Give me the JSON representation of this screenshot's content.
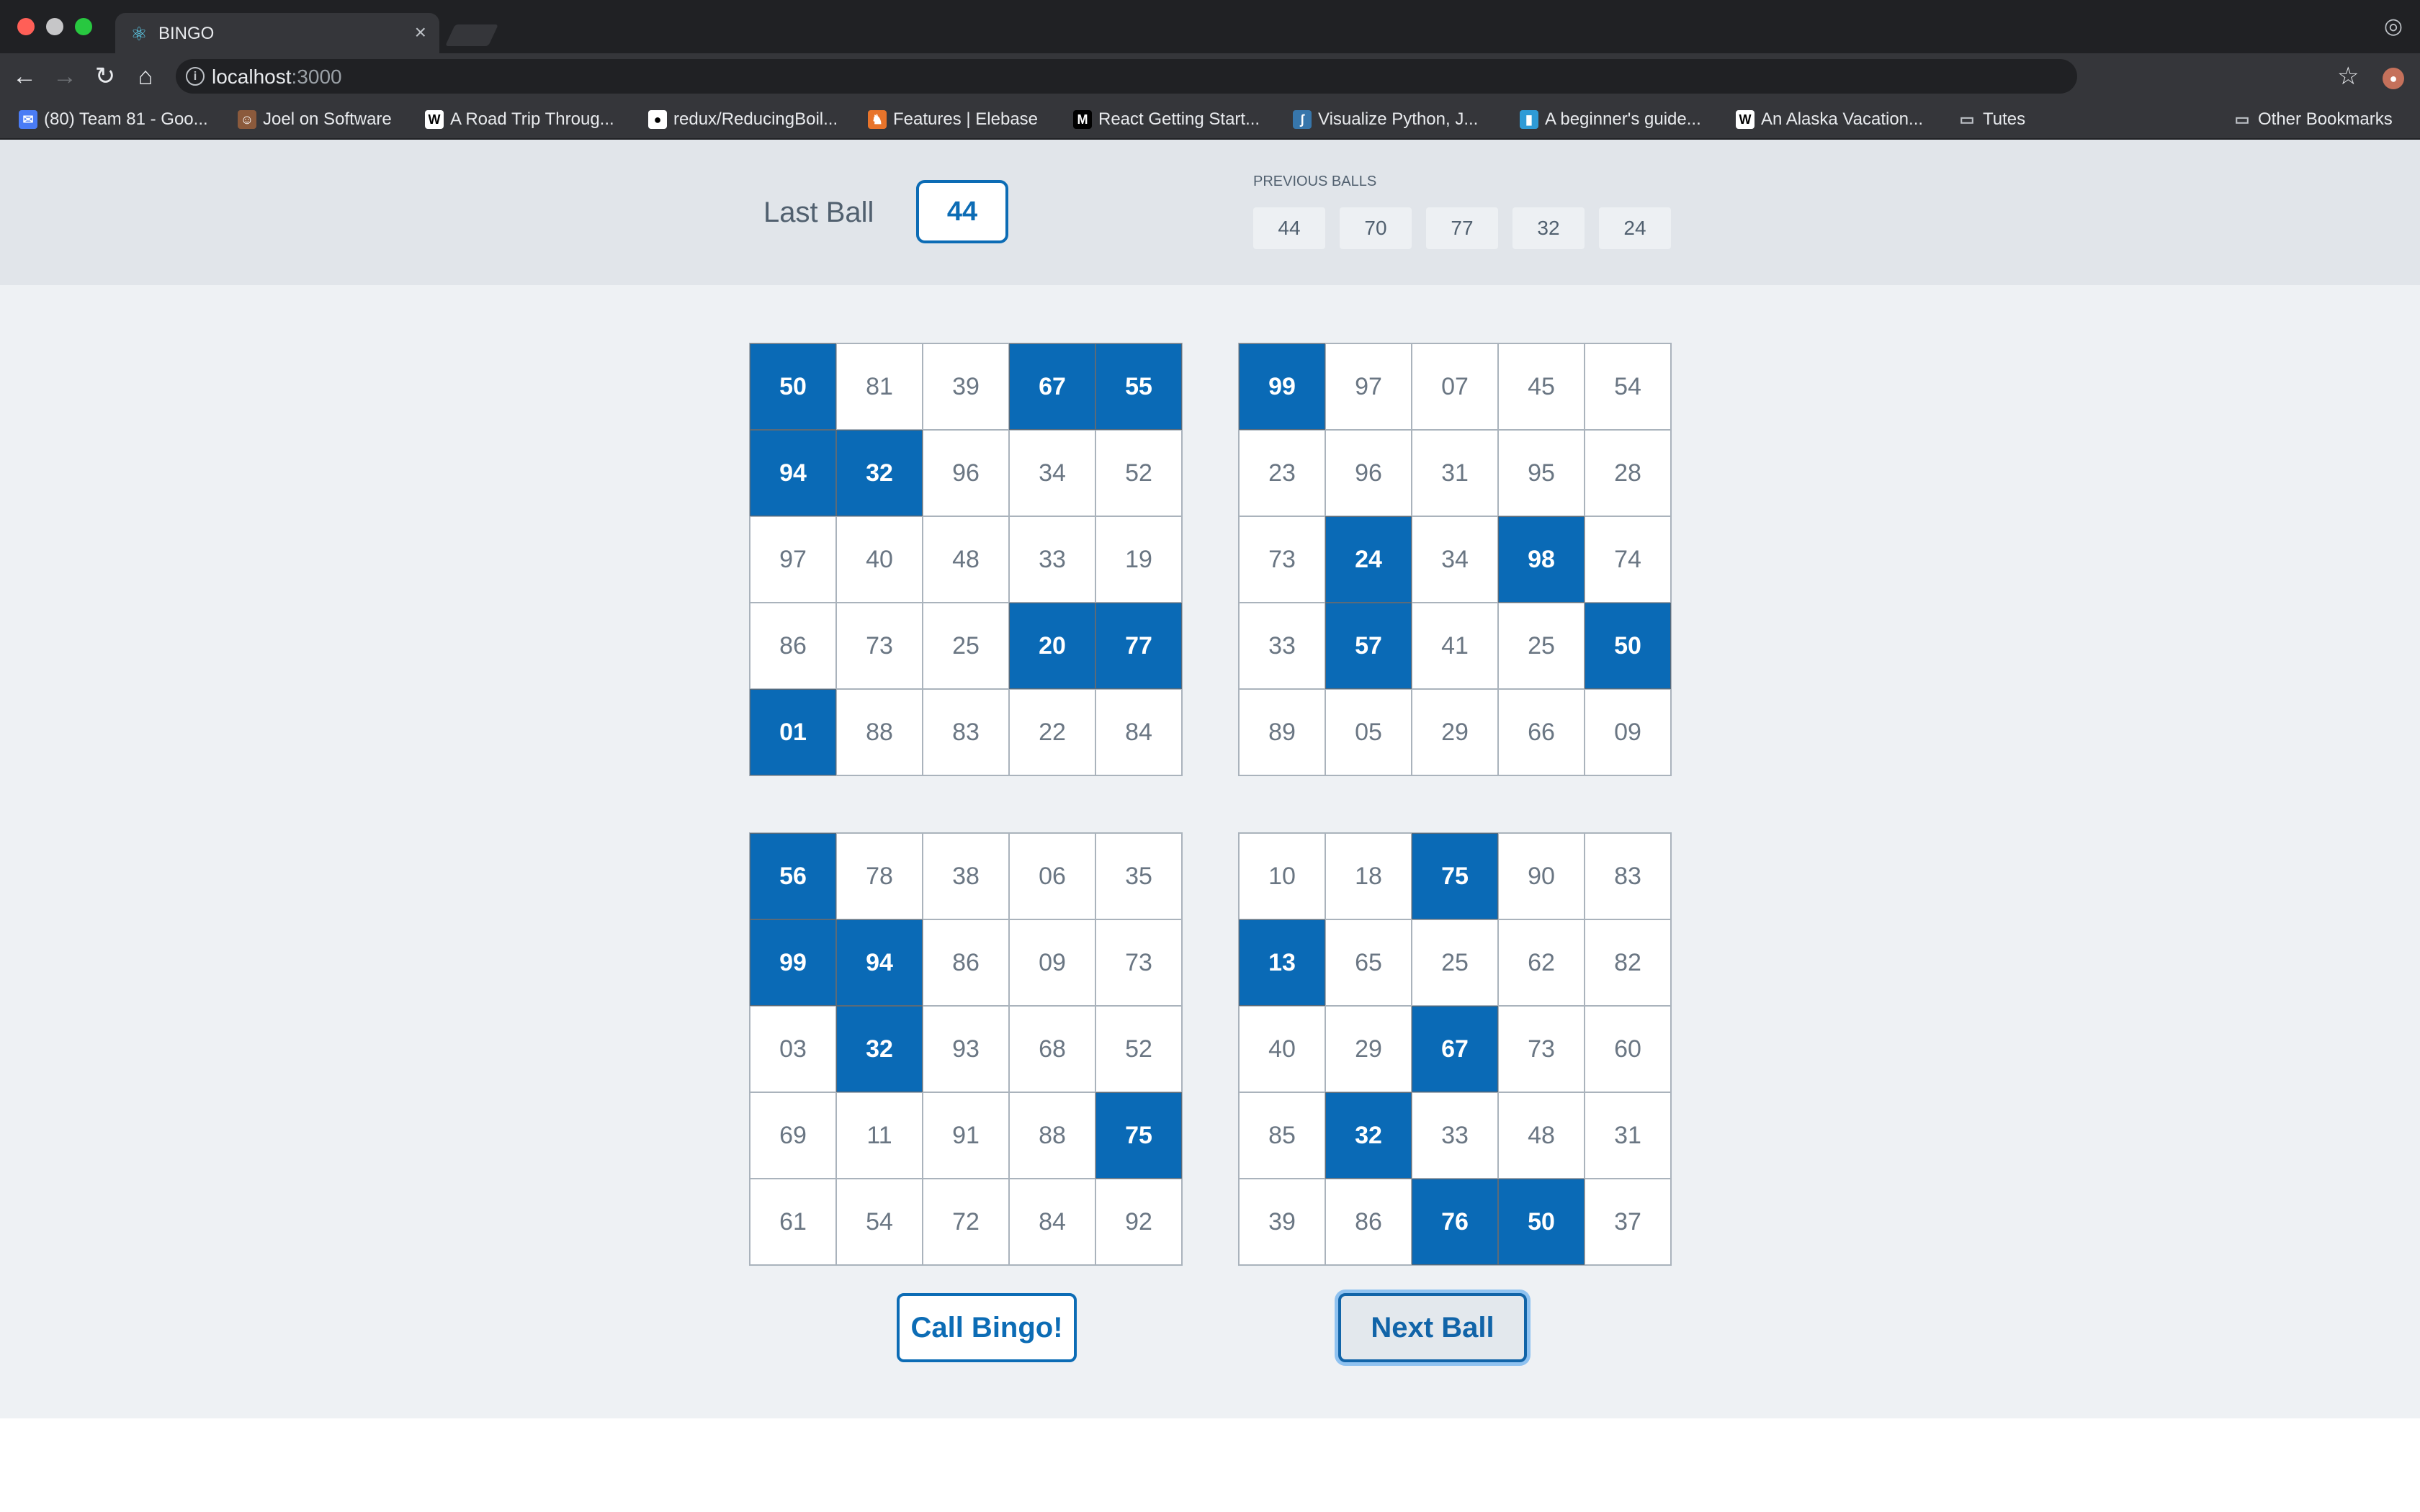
{
  "browser": {
    "tab_title": "BINGO",
    "url_host": "localhost",
    "url_port": ":3000",
    "bookmarks": [
      {
        "label": "(80) Team 81 - Goo...",
        "icon": "chat-icon",
        "color": "#4a7cf5"
      },
      {
        "label": "Joel on Software",
        "icon": "person-icon",
        "color": "#8b5a3c"
      },
      {
        "label": "A Road Trip Throug...",
        "icon": "wsj-icon",
        "color": "#ffffff"
      },
      {
        "label": "redux/ReducingBoil...",
        "icon": "github-icon",
        "color": "#ffffff"
      },
      {
        "label": "Features | Elebase",
        "icon": "elephant-icon",
        "color": "#e8742b"
      },
      {
        "label": "React Getting Start...",
        "icon": "medium-icon",
        "color": "#000000"
      },
      {
        "label": "Visualize Python, J...",
        "icon": "python-icon",
        "color": "#3776ab"
      },
      {
        "label": "A beginner's guide...",
        "icon": "bottle-icon",
        "color": "#2f9bd6"
      },
      {
        "label": "An Alaska Vacation...",
        "icon": "wsj-icon",
        "color": "#ffffff"
      },
      {
        "label": "Tutes",
        "icon": "folder-icon",
        "color": "#bdc1c6"
      },
      {
        "label": "Other Bookmarks",
        "icon": "folder-icon",
        "color": "#bdc1c6"
      }
    ]
  },
  "header": {
    "last_ball_label": "Last Ball",
    "last_ball": "44",
    "previous_label": "PREVIOUS BALLS",
    "previous_balls": [
      "44",
      "70",
      "77",
      "32",
      "24"
    ]
  },
  "cards": [
    {
      "numbers": [
        [
          "50",
          "81",
          "39",
          "67",
          "55"
        ],
        [
          "94",
          "32",
          "96",
          "34",
          "52"
        ],
        [
          "97",
          "40",
          "48",
          "33",
          "19"
        ],
        [
          "86",
          "73",
          "25",
          "20",
          "77"
        ],
        [
          "01",
          "88",
          "83",
          "22",
          "84"
        ]
      ],
      "marked": [
        [
          true,
          false,
          false,
          true,
          true
        ],
        [
          true,
          true,
          false,
          false,
          false
        ],
        [
          false,
          false,
          false,
          false,
          false
        ],
        [
          false,
          false,
          false,
          true,
          true
        ],
        [
          true,
          false,
          false,
          false,
          false
        ]
      ]
    },
    {
      "numbers": [
        [
          "99",
          "97",
          "07",
          "45",
          "54"
        ],
        [
          "23",
          "96",
          "31",
          "95",
          "28"
        ],
        [
          "73",
          "24",
          "34",
          "98",
          "74"
        ],
        [
          "33",
          "57",
          "41",
          "25",
          "50"
        ],
        [
          "89",
          "05",
          "29",
          "66",
          "09"
        ]
      ],
      "marked": [
        [
          true,
          false,
          false,
          false,
          false
        ],
        [
          false,
          false,
          false,
          false,
          false
        ],
        [
          false,
          true,
          false,
          true,
          false
        ],
        [
          false,
          true,
          false,
          false,
          true
        ],
        [
          false,
          false,
          false,
          false,
          false
        ]
      ]
    },
    {
      "numbers": [
        [
          "56",
          "78",
          "38",
          "06",
          "35"
        ],
        [
          "99",
          "94",
          "86",
          "09",
          "73"
        ],
        [
          "03",
          "32",
          "93",
          "68",
          "52"
        ],
        [
          "69",
          "11",
          "91",
          "88",
          "75"
        ],
        [
          "61",
          "54",
          "72",
          "84",
          "92"
        ]
      ],
      "marked": [
        [
          true,
          false,
          false,
          false,
          false
        ],
        [
          true,
          true,
          false,
          false,
          false
        ],
        [
          false,
          true,
          false,
          false,
          false
        ],
        [
          false,
          false,
          false,
          false,
          true
        ],
        [
          false,
          false,
          false,
          false,
          false
        ]
      ]
    },
    {
      "numbers": [
        [
          "10",
          "18",
          "75",
          "90",
          "83"
        ],
        [
          "13",
          "65",
          "25",
          "62",
          "82"
        ],
        [
          "40",
          "29",
          "67",
          "73",
          "60"
        ],
        [
          "85",
          "32",
          "33",
          "48",
          "31"
        ],
        [
          "39",
          "86",
          "76",
          "50",
          "37"
        ]
      ],
      "marked": [
        [
          false,
          false,
          true,
          false,
          false
        ],
        [
          true,
          false,
          false,
          false,
          false
        ],
        [
          false,
          false,
          true,
          false,
          false
        ],
        [
          false,
          true,
          false,
          false,
          false
        ],
        [
          false,
          false,
          true,
          true,
          false
        ]
      ]
    }
  ],
  "actions": {
    "call_bingo": "Call Bingo!",
    "next_ball": "Next Ball"
  },
  "colors": {
    "marked": "#0a6ab6",
    "accent": "#0c6cb5"
  }
}
